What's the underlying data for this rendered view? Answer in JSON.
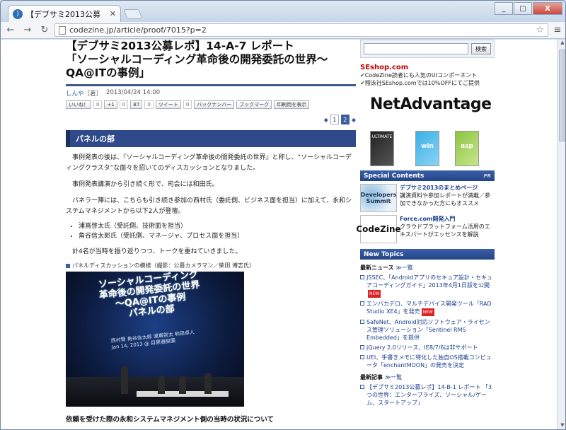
{
  "browser": {
    "tab_title": "【デブサミ2013公募",
    "url": "codezine.jp/article/proof/7015?p=2",
    "minimize": "_",
    "maximize": "□",
    "close": "X"
  },
  "article": {
    "title_line1": "【デブサミ2013公募レポ】14-A-7 レポート",
    "title_line2": "「ソーシャルコーディング革命後の開発委託の世界〜",
    "title_line3": "QA@ITの事例」",
    "author": "しんや",
    "author_suffix": "［著］",
    "date": "2013/04/24 14:00",
    "share": {
      "like": "いいね！",
      "like_count": "0",
      "gplus": "+1",
      "gplus_count": "0",
      "bt": "BT",
      "bt_count": "0",
      "tweet": "ツイート",
      "tweet_count": "0",
      "backnumber": "バックナンバー",
      "bookmark": "ブックマーク",
      "print": "印刷用を表示"
    },
    "pager": {
      "page1": "1",
      "page2": "2"
    },
    "section_title": "パネルの部",
    "para1": "事例発表の後は、『ソーシャルコーディング革命後の開発委託の世界』と称し、“ソーシャルコーディングクラスタ”な面々を招いてのディスカッションとなりました。",
    "para2": "事例発表講演から引き続く形で、司会には和田氏。",
    "para3": "パネラー陣には、こちらも引き続き参加の西村氏（委託側、ビジネス面を担当）に加えて、永和システムマネジメントから以下2人が登壇。",
    "bullets": [
      "浦嶌啓太氏（受託側、技術面を担当）",
      "角谷信太郎氏（受託側、マネージャ、プロセス面を担当）"
    ],
    "para4": "計4名が当時を振り返りつつ、トークを重ねていきました。",
    "caption": "パネルディスカッションの模様（撮影：公募カメラマン／柴田 博志氏）",
    "slide_l1": "ソーシャルコーディング",
    "slide_l2": "革命後の開発委託の世界",
    "slide_l3": "〜QA@ITの事例",
    "slide_l4": "パネルの部",
    "slide_sub1": "西村賢 角谷信太郎 浦嶌啓太 和田卓人",
    "slide_sub2": "Jan 14, 2013 @ 目黒雅叙園",
    "subhead": "依頼を受けた際の永和システムマネジメント側の当時の状況について"
  },
  "sidebar": {
    "search_button": "検索",
    "promo_logo_se": "SE",
    "promo_logo_rest": "shop.com",
    "promo_line1": "CodeZine読者にも人気のUIコンポーネント",
    "promo_line2": "翔泳社SEshop.comでは10%OFFにてご提供",
    "ad_title": "NetAdvantage",
    "ad_box1": "ULTIMATE",
    "ad_box2": "win",
    "ad_box3": "asp",
    "special_contents": "Special Contents",
    "pr": "PR",
    "sc_items": [
      {
        "img": "Developers Summit",
        "title": "デブサミ2013のまとめページ",
        "desc": "講演資料や参加レポートが満載／参加できなかった方にもオススメ"
      },
      {
        "img": "CodeZine",
        "title": "Force.com開発入門",
        "desc": "クラウドプラットフォーム活用のエキスパートがエッセンスを解説"
      }
    ],
    "new_topics": "New Topics",
    "latest_news": "最新ニュース",
    "more": "≫一覧",
    "news": [
      "JSSEC、「Androidアプリのセキュア設計・セキュアコーディングガイド」2013年4月1日版を公開",
      "エンバカデロ、マルチデバイス開発ツール「RAD Studio XE4」を発売",
      "SafeNet、Android対応ソフトウェア・ライセンス管理ソリューション「Sentinel RMS Embedded」を提供",
      "jQuery 2.0リリース、IE8/7/6は非サポート",
      "UEI、手書きメモに特化した独自OS搭載コンピュータ「enchantMOON」の発売を決定"
    ],
    "new_badge": "NEW",
    "latest_articles": "最新記事",
    "articles": [
      "【デブサミ2013公募レポ】14-B-1 レポート 「3つの世界：エンタープライズ、ソーシャル/ゲーム、スタートアップ」"
    ]
  },
  "colors": {
    "accent": "#2e4a8a",
    "link": "#1a3f8c"
  }
}
